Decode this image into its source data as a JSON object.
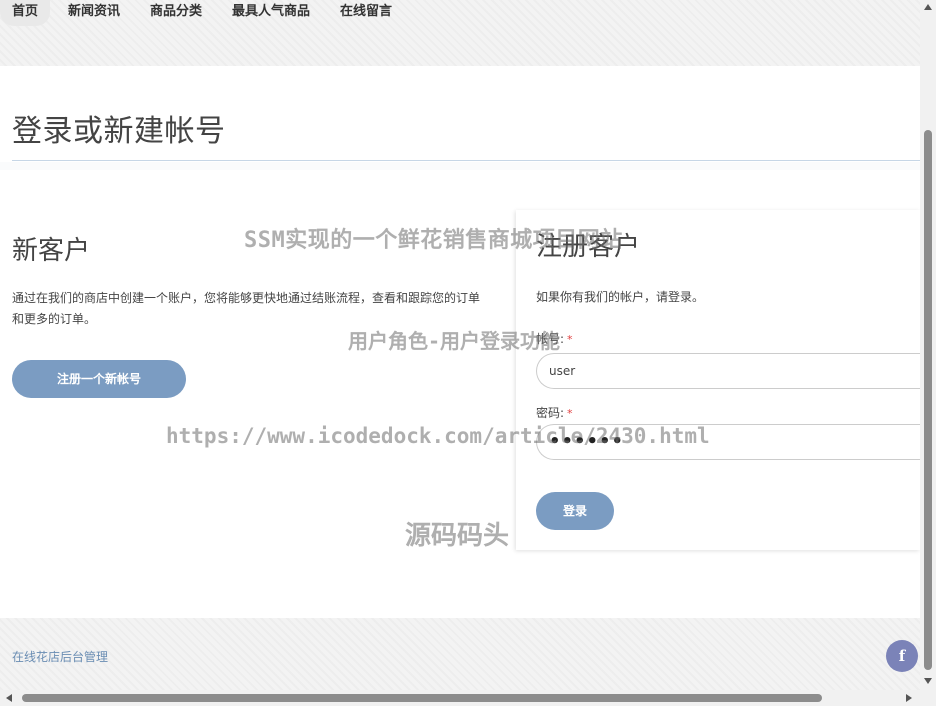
{
  "nav": {
    "items": [
      {
        "label": "首页",
        "active": true
      },
      {
        "label": "新闻资讯"
      },
      {
        "label": "商品分类"
      },
      {
        "label": "最具人气商品"
      },
      {
        "label": "在线留言"
      }
    ]
  },
  "page": {
    "title": "登录或新建帐号"
  },
  "new_customer": {
    "heading": "新客户",
    "description": "通过在我们的商店中创建一个账户，您将能够更快地通过结账流程，查看和跟踪您的订单和更多的订单。",
    "register_button": "注册一个新帐号"
  },
  "login": {
    "heading": "注册客户",
    "description": "如果你有我们的帐户，请登录。",
    "account_label": "帐号:",
    "account_value": "user",
    "password_label": "密码:",
    "required_mark": "*",
    "password_mask": "••••••",
    "login_button": "登录"
  },
  "footer": {
    "admin_link": "在线花店后台管理",
    "social_icon": "facebook-icon",
    "social_glyph": "f"
  },
  "watermarks": {
    "line1": "SSM实现的一个鲜花销售商城项目网站",
    "line2": "用户角色-用户登录功能",
    "line3": "https://www.icodedock.com/article/2430.html",
    "line4": "源码码头"
  },
  "colors": {
    "accent": "#7b9cc2",
    "link": "#6a8db3",
    "required": "#e04040",
    "facebook": "#7b83b8"
  }
}
